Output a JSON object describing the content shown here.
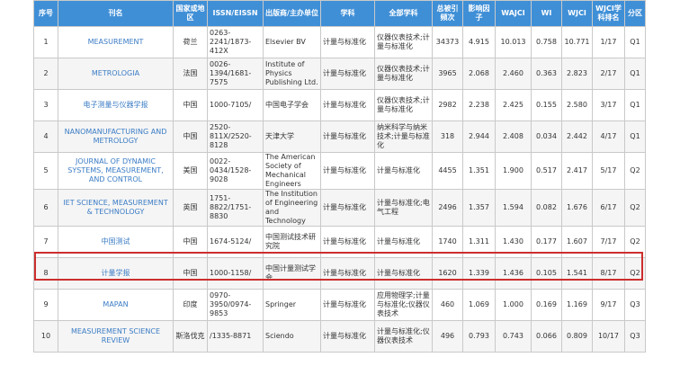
{
  "headers": {
    "no": "序号",
    "name": "刊名",
    "country": "国家或地区",
    "issn": "ISSN/EISSN",
    "publisher": "出版商/主办单位",
    "subject": "学科",
    "all_subjects": "全部学科",
    "cites": "总被引频次",
    "impact": "影响因子",
    "wajci": "WAJCI",
    "wi": "WI",
    "wjci": "WJCI",
    "rank": "WJCI学科排名",
    "zone": "分区"
  },
  "rows": [
    {
      "no": "1",
      "name": "MEASUREMENT",
      "country": "荷兰",
      "issn": "0263-2241/1873-412X",
      "publisher": "Elsevier BV",
      "subject": "计量与标准化",
      "all_subjects": "仪器仪表技术;计量与标准化",
      "cites": "34373",
      "impact": "4.915",
      "wajci": "10.013",
      "wi": "0.758",
      "wjci": "10.771",
      "rank": "1/17",
      "zone": "Q1"
    },
    {
      "no": "2",
      "name": "METROLOGIA",
      "country": "法国",
      "issn": "0026-1394/1681-7575",
      "publisher": "Institute of Physics Publishing Ltd.",
      "subject": "计量与标准化",
      "all_subjects": "仪器仪表技术;计量与标准化",
      "cites": "3965",
      "impact": "2.068",
      "wajci": "2.460",
      "wi": "0.363",
      "wjci": "2.823",
      "rank": "2/17",
      "zone": "Q1"
    },
    {
      "no": "3",
      "name": "电子测量与仪器学报",
      "country": "中国",
      "issn": "1000-7105/",
      "publisher": "中国电子学会",
      "subject": "计量与标准化",
      "all_subjects": "仪器仪表技术;计量与标准化",
      "cites": "2982",
      "impact": "2.238",
      "wajci": "2.425",
      "wi": "0.155",
      "wjci": "2.580",
      "rank": "3/17",
      "zone": "Q1"
    },
    {
      "no": "4",
      "name": "NANOMANUFACTURING AND METROLOGY",
      "country": "中国",
      "issn": "2520-811X/2520-8128",
      "publisher": "天津大学",
      "subject": "计量与标准化",
      "all_subjects": "纳米科学与纳米技术;计量与标准化",
      "cites": "318",
      "impact": "2.944",
      "wajci": "2.408",
      "wi": "0.034",
      "wjci": "2.442",
      "rank": "4/17",
      "zone": "Q1"
    },
    {
      "no": "5",
      "name": "JOURNAL OF DYNAMIC SYSTEMS, MEASUREMENT, AND CONTROL",
      "country": "美国",
      "issn": "0022-0434/1528-9028",
      "publisher": "The American Society of Mechanical Engineers",
      "subject": "计量与标准化",
      "all_subjects": "计量与标准化",
      "cites": "4455",
      "impact": "1.351",
      "wajci": "1.900",
      "wi": "0.517",
      "wjci": "2.417",
      "rank": "5/17",
      "zone": "Q2"
    },
    {
      "no": "6",
      "name": "IET SCIENCE, MEASUREMENT & TECHNOLOGY",
      "country": "英国",
      "issn": "1751-8822/1751-8830",
      "publisher": "The Institution of Engineering and Technology",
      "subject": "计量与标准化",
      "all_subjects": "计量与标准化;电气工程",
      "cites": "2496",
      "impact": "1.357",
      "wajci": "1.594",
      "wi": "0.082",
      "wjci": "1.676",
      "rank": "6/17",
      "zone": "Q2"
    },
    {
      "no": "7",
      "name": "中国测试",
      "country": "中国",
      "issn": "1674-5124/",
      "publisher": "中国测试技术研究院",
      "subject": "计量与标准化",
      "all_subjects": "计量与标准化",
      "cites": "1740",
      "impact": "1.311",
      "wajci": "1.430",
      "wi": "0.177",
      "wjci": "1.607",
      "rank": "7/17",
      "zone": "Q2"
    },
    {
      "no": "8",
      "name": "计量学报",
      "country": "中国",
      "issn": "1000-1158/",
      "publisher": "中国计量测试学会",
      "subject": "计量与标准化",
      "all_subjects": "计量与标准化",
      "cites": "1620",
      "impact": "1.339",
      "wajci": "1.436",
      "wi": "0.105",
      "wjci": "1.541",
      "rank": "8/17",
      "zone": "Q2"
    },
    {
      "no": "9",
      "name": "MAPAN",
      "country": "印度",
      "issn": "0970-3950/0974-9853",
      "publisher": "Springer",
      "subject": "计量与标准化",
      "all_subjects": "应用物理学;计量与标准化;仪器仪表技术",
      "cites": "460",
      "impact": "1.069",
      "wajci": "1.000",
      "wi": "0.169",
      "wjci": "1.169",
      "rank": "9/17",
      "zone": "Q3"
    },
    {
      "no": "10",
      "name": "MEASUREMENT SCIENCE REVIEW",
      "country": "斯洛伐克",
      "issn": "/1335-8871",
      "publisher": "Sciendo",
      "subject": "计量与标准化",
      "all_subjects": "计量与标准化;仪器仪表技术",
      "cites": "496",
      "impact": "0.793",
      "wajci": "0.743",
      "wi": "0.066",
      "wjci": "0.809",
      "rank": "10/17",
      "zone": "Q3"
    }
  ],
  "colors": {
    "header_bg": "#3f8fd7",
    "link": "#3b7cc5",
    "highlight": "#cc2e2e"
  }
}
